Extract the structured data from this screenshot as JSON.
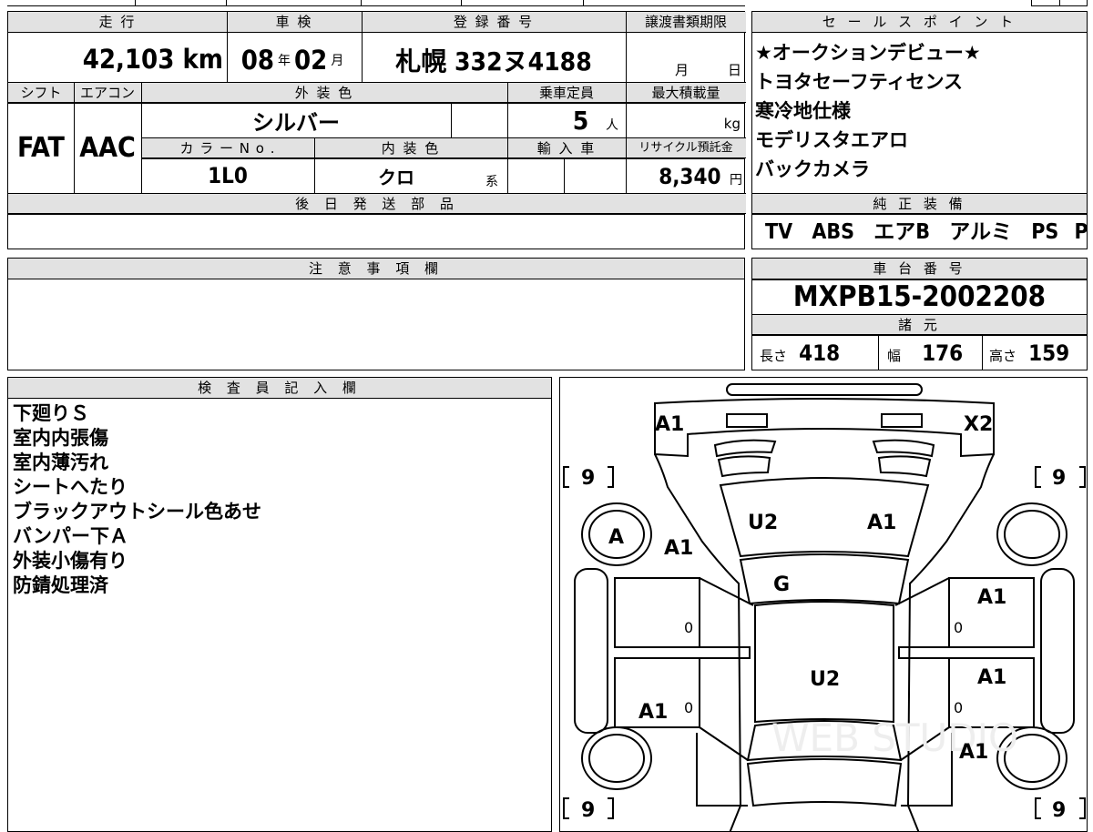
{
  "header": {
    "mileage_label": "走 行",
    "shaken_label": "車 検",
    "registration_label": "登 録 番 号",
    "transfer_deadline_label": "譲渡書類期限",
    "shift_label": "シフト",
    "aircon_label": "エアコン",
    "exterior_color_label": "外 装 色",
    "capacity_label": "乗車定員",
    "max_load_label": "最大積載量",
    "color_no_label": "カ ラ ー N o .",
    "interior_color_label": "内 装 色",
    "import_label": "輸 入 車",
    "recycle_label": "リサイクル預託金"
  },
  "vehicle": {
    "mileage": "42,103",
    "mileage_unit": "km",
    "shaken_year": "08",
    "shaken_year_unit": "年",
    "shaken_month": "02",
    "shaken_month_unit": "月",
    "registration": "札幌 332ヌ4188",
    "deadline_month_unit": "月",
    "deadline_day_unit": "日",
    "shift": "FAT",
    "aircon": "AAC",
    "exterior_color": "シルバー",
    "capacity": "5",
    "capacity_unit": "人",
    "max_load_unit": "kg",
    "color_no": "1L0",
    "interior_color": "クロ",
    "interior_suffix": "系",
    "recycle_fee": "8,340",
    "recycle_unit": "円"
  },
  "later_parts": {
    "label": "後 日 発 送 部 品"
  },
  "caution": {
    "label": "注 意 事 項 欄"
  },
  "sales_points": {
    "label": "セ ー ル ス ポ イ ン ト",
    "items": [
      "★オークションデビュー★",
      "トヨタセーフティセンス",
      "寒冷地仕様",
      "モデリスタエアロ",
      "バックカメラ"
    ]
  },
  "equipment": {
    "label": "純 正 装 備",
    "items": [
      "TV",
      "ABS",
      "エアB",
      "アルミ",
      "PS",
      "PW"
    ]
  },
  "chassis": {
    "label": "車 台 番 号",
    "number": "MXPB15-2002208"
  },
  "specs": {
    "label": "諸 元",
    "length_label": "長さ",
    "length": "418",
    "width_label": "幅",
    "width": "176",
    "height_label": "高さ",
    "height": "159"
  },
  "inspector": {
    "label": "検 査 員 記 入 欄",
    "notes": [
      "下廻りＳ",
      "室内内張傷",
      "室内薄汚れ",
      "シートへたり",
      "ブラックアウトシール色あせ",
      "バンパー下Ａ",
      "外装小傷有り",
      "防錆処理済"
    ]
  },
  "diagram": {
    "marks": {
      "front_left": "A1",
      "front_right": "X2",
      "hood_left": "U2",
      "hood_right": "A1",
      "glass": "G",
      "roof": "U2",
      "left_wheel": "A",
      "left_fender": "A1",
      "right_front_door": "A1",
      "right_rear_door": "A1",
      "right_quarter": "A1",
      "left_quarter": "A1"
    },
    "tire_fl": "9",
    "tire_fr": "9",
    "tire_rl": "9",
    "tire_rr": "9",
    "door_marks": [
      "0",
      "0",
      "0",
      "0"
    ],
    "watermark": "WEB STUDIO"
  }
}
